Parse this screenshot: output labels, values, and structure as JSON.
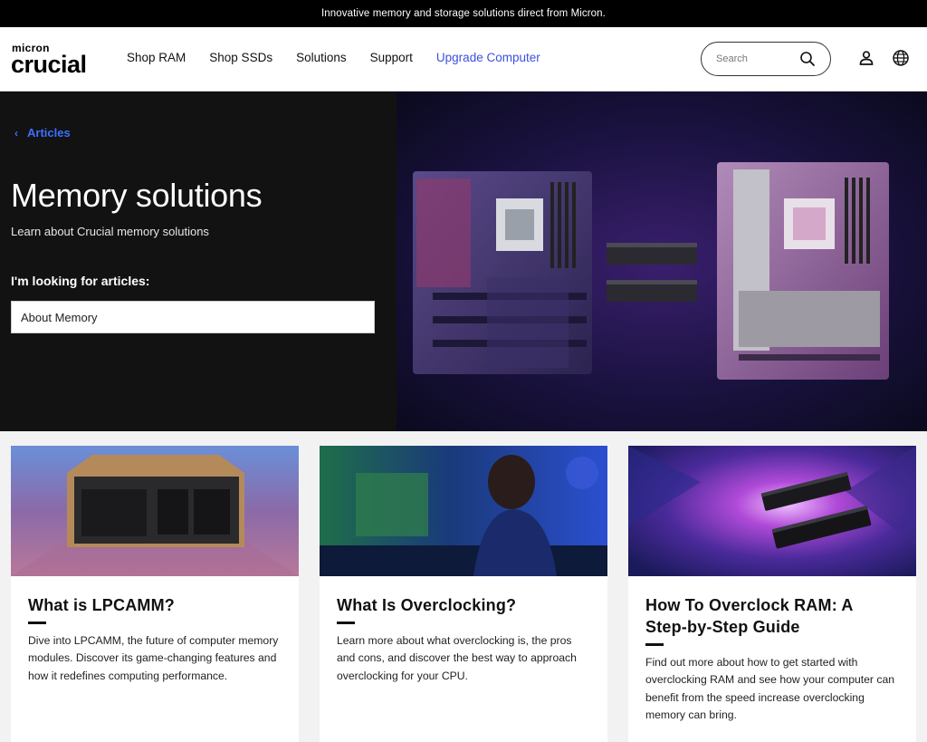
{
  "promo": {
    "text": "Innovative memory and storage solutions direct from Micron."
  },
  "brand": {
    "small": "micron",
    "large": "crucial"
  },
  "nav": {
    "items": [
      "Shop RAM",
      "Shop SSDs",
      "Solutions",
      "Support",
      "Upgrade Computer"
    ],
    "accent_color": "#3d4fe0"
  },
  "search": {
    "placeholder": "Search",
    "icon": "search-icon"
  },
  "header_icons": [
    "account-icon",
    "globe-icon"
  ],
  "hero": {
    "breadcrumb": "Articles",
    "title": "Memory solutions",
    "subtitle": "Learn about Crucial memory solutions",
    "filter_label": "I'm looking for articles:",
    "filter_value": "About Memory"
  },
  "cards": [
    {
      "title": "What is LPCAMM?",
      "body": "Dive into LPCAMM, the future of computer memory modules. Discover its game-changing features and how it redefines computing performance."
    },
    {
      "title": "What Is Overclocking?",
      "body": "Learn more about what overclocking is, the pros and cons, and discover the best way to approach overclocking for your CPU."
    },
    {
      "title": "How To Overclock RAM: A Step-by-Step Guide",
      "body": "Find out more about how to get started with overclocking RAM and see how your computer can benefit from the speed increase overclocking memory can bring."
    }
  ]
}
